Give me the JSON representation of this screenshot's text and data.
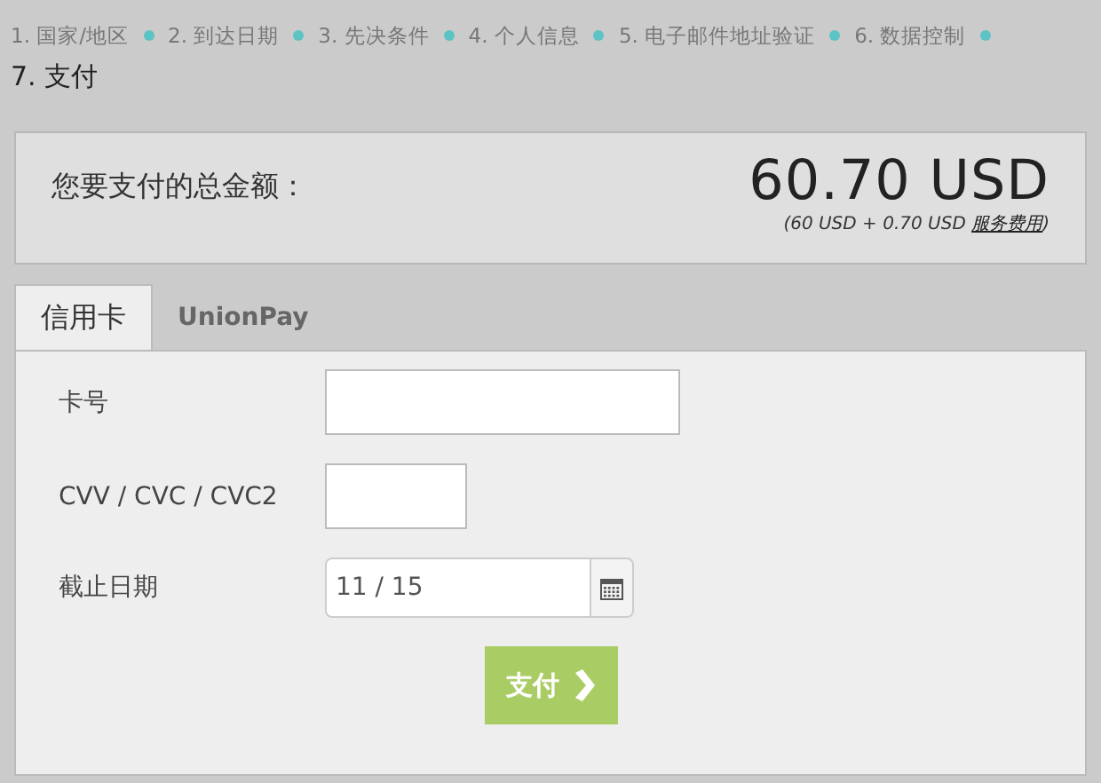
{
  "steps": [
    {
      "label": "1. 国家/地区",
      "selected": false
    },
    {
      "label": "2. 到达日期",
      "selected": false
    },
    {
      "label": "3. 先决条件",
      "selected": false
    },
    {
      "label": "4. 个人信息",
      "selected": false
    },
    {
      "label": "5. 电子邮件地址验证",
      "selected": false
    },
    {
      "label": "6. 数据控制",
      "selected": false
    },
    {
      "label": "7. 支付",
      "selected": true
    }
  ],
  "summary": {
    "label": "您要支付的总金额：",
    "total": "60.70 USD",
    "breakdown": "(60 USD + 0.70 USD ",
    "fee_link": "服务费用",
    "breakdown_end": ")"
  },
  "tabs": [
    {
      "label": "信用卡",
      "selected": true
    },
    {
      "label": "UnionPay",
      "selected": false
    }
  ],
  "fields": [
    {
      "kind": "text",
      "label": "卡号"
    },
    {
      "kind": "code",
      "label": "CVV / CVC / CVC2"
    },
    {
      "kind": "date",
      "label": "截止日期",
      "value": "11 / 15"
    }
  ],
  "pay_button": {
    "label": "支付"
  }
}
